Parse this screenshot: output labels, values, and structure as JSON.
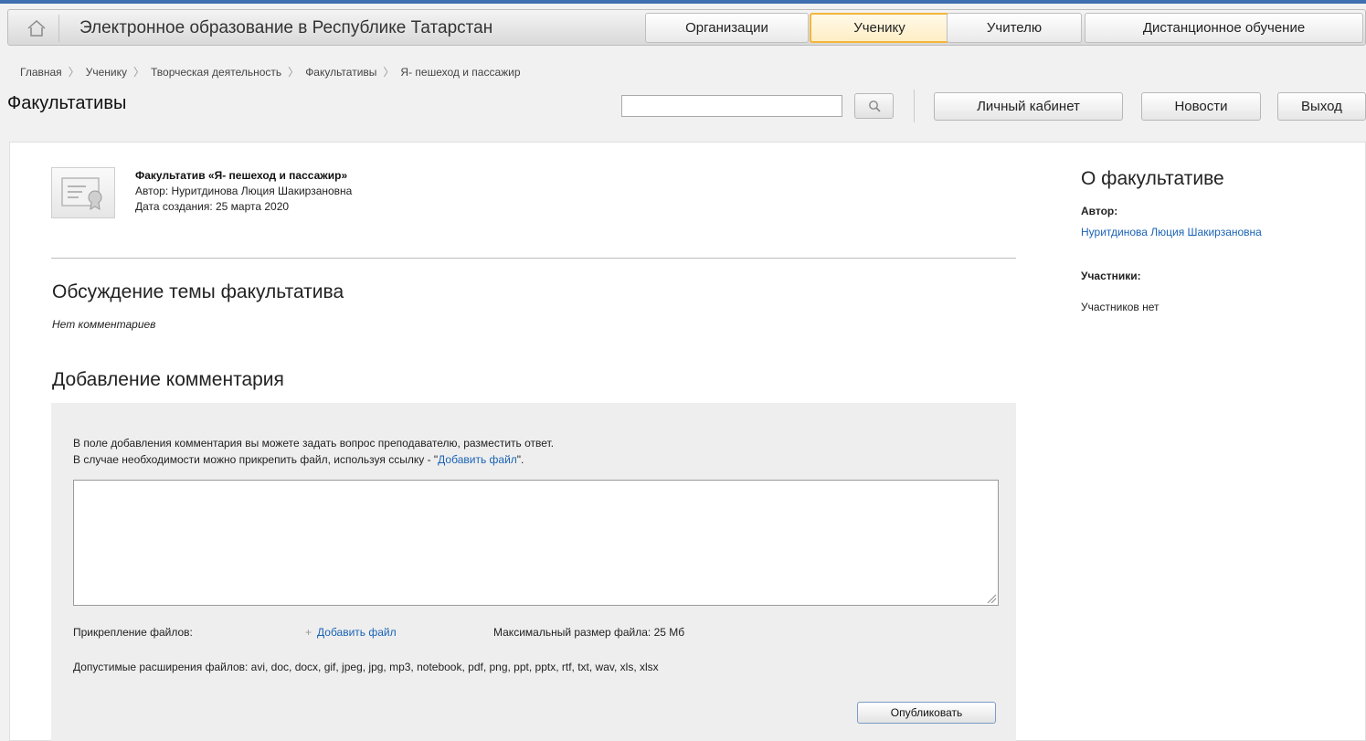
{
  "header": {
    "site_title": "Электронное образование в Республике Татарстан",
    "nav": [
      "Организации",
      "Ученику",
      "Учителю",
      "Дистанционное обучение"
    ],
    "active_nav": "Ученику"
  },
  "breadcrumb": [
    "Главная",
    "Ученику",
    "Творческая деятельность",
    "Факультативы",
    "Я- пешеход и пассажир"
  ],
  "page_title": "Факультативы",
  "search": {
    "value": ""
  },
  "actions": {
    "cabinet": "Личный кабинет",
    "news": "Новости",
    "exit": "Выход"
  },
  "course": {
    "title": "Факультатив «Я- пешеход и пассажир»",
    "author": "Автор: Нуритдинова Люция Шакирзановна",
    "created": "Дата создания: 25 марта 2020"
  },
  "discussion": {
    "heading": "Обсуждение темы факультатива",
    "empty": "Нет комментариев"
  },
  "add_comment": {
    "heading": "Добавление комментария",
    "hint_line1": "В поле добавления комментария вы можете задать вопрос преподавателю, разместить ответ.",
    "hint_line2_prefix": "В случае необходимости можно прикрепить файл, используя ссылку - \"",
    "hint_link": "Добавить файл",
    "hint_line2_suffix": "\".",
    "textarea_value": "",
    "attach_label": "Прикрепление файлов:",
    "add_file": "Добавить файл",
    "max_size": "Максимальный размер файла: 25 Мб",
    "extensions": "Допустимые расширения файлов: avi, doc, docx, gif, jpeg, jpg, mp3, notebook, pdf, png, ppt, pptx, rtf, txt, wav, xls, xlsx",
    "publish": "Опубликовать"
  },
  "sidebar": {
    "title": "О факультативе",
    "author_label": "Автор:",
    "author_name": "Нуритдинова Люция Шакирзановна",
    "participants_label": "Участники:",
    "participants_value": "Участников нет"
  },
  "icons": {
    "home": "home-icon",
    "search": "search-icon",
    "course_image": "certificate-icon"
  },
  "colors": {
    "link": "#1a63b5",
    "active_tab_border": "#f5b53a",
    "accent_strip": "#3e6fb0"
  }
}
